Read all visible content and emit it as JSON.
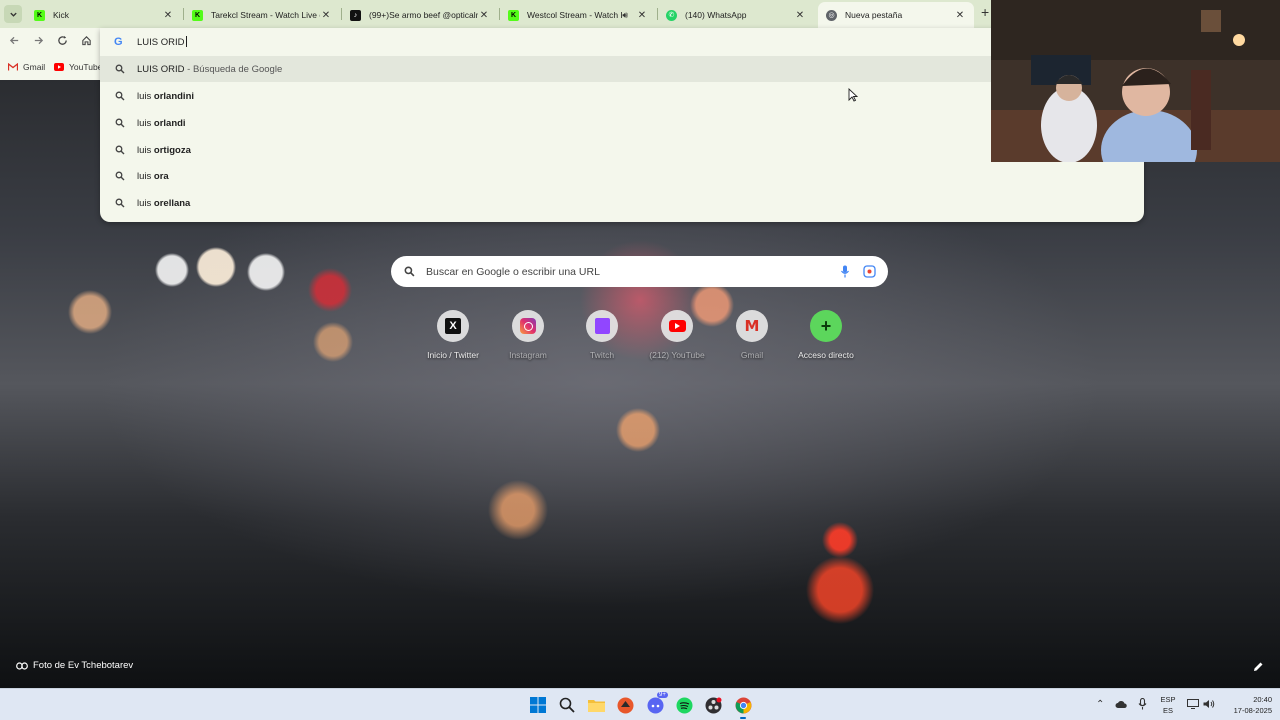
{
  "tabs": [
    {
      "title": "Kick",
      "favicon": "kick-icon",
      "active": false
    },
    {
      "title": "Tarekcl Stream - Watch Live on",
      "favicon": "kick-icon",
      "active": false
    },
    {
      "title": "(99+)Se armo beef @opticalm",
      "favicon": "tiktok-icon",
      "active": false
    },
    {
      "title": "Westcol Stream - Watch Liv",
      "favicon": "kick-icon",
      "active": false,
      "audio": true
    },
    {
      "title": "(140) WhatsApp",
      "favicon": "whatsapp-icon",
      "active": false
    },
    {
      "title": "Nueva pestaña",
      "favicon": "chrome-icon",
      "active": true
    }
  ],
  "omnibox": {
    "value": "LUIS ORID",
    "suggestions": [
      {
        "prefix": "LUIS ORID",
        "bold": "",
        "suffix": " - Búsqueda de Google"
      },
      {
        "prefix": "luis ",
        "bold": "orlandini",
        "suffix": ""
      },
      {
        "prefix": "luis ",
        "bold": "orlandi",
        "suffix": ""
      },
      {
        "prefix": "luis ",
        "bold": "ortigoza",
        "suffix": ""
      },
      {
        "prefix": "luis ",
        "bold": "ora",
        "suffix": ""
      },
      {
        "prefix": "luis ",
        "bold": "orellana",
        "suffix": ""
      }
    ]
  },
  "bookmarks": [
    {
      "label": "Gmail",
      "icon": "gmail-icon"
    },
    {
      "label": "YouTube",
      "icon": "youtube-icon"
    }
  ],
  "ntp": {
    "search_placeholder": "Buscar en Google o escribir una URL",
    "shortcuts": [
      {
        "label": "Inicio / Twitter",
        "icon": "x-icon"
      },
      {
        "label": "Instagram",
        "icon": "instagram-icon"
      },
      {
        "label": "Twitch",
        "icon": "twitch-icon"
      },
      {
        "label": "(212) YouTube",
        "icon": "youtube-icon"
      },
      {
        "label": "Gmail",
        "icon": "gmail-icon"
      },
      {
        "label": "Acceso directo",
        "icon": "plus-icon"
      }
    ],
    "photo_credit": "Foto de Ev Tchebotarev"
  },
  "taskbar": {
    "language": "ESP",
    "layout": "ES",
    "time": "20:40",
    "date": "17-08-2025",
    "discord_badge": "9+"
  },
  "colors": {
    "tabstrip": "#dde8cf",
    "toolbar": "#f4f7ec",
    "taskbar": "#dfe7f3",
    "kick": "#53fc18",
    "add_shortcut": "#5cd65c"
  }
}
